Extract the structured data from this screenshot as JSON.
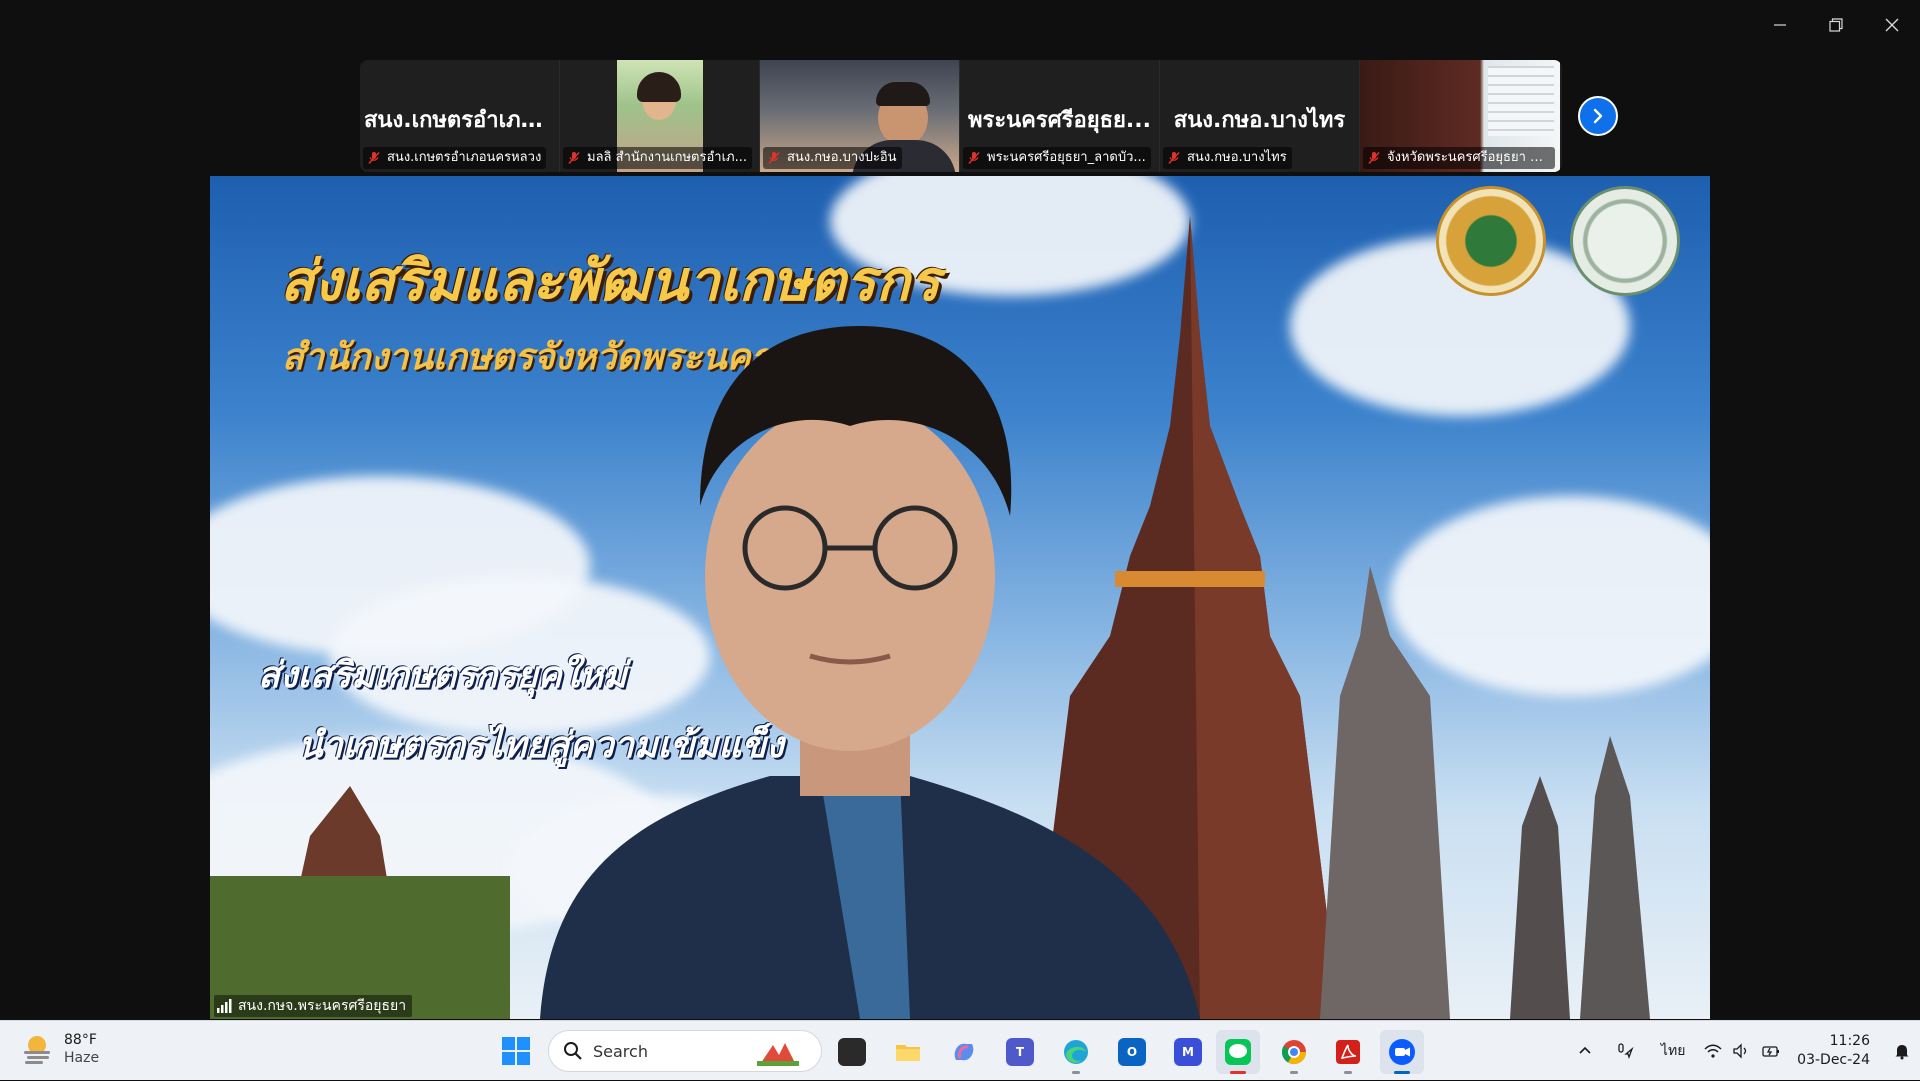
{
  "participants": [
    {
      "display_name": "สนง.เกษตรอำเภอ...",
      "caption": "สนง.เกษตรอำเภอนครหลวง",
      "video": false
    },
    {
      "display_name": "",
      "caption": "มลลิ สำนักงานเกษตรอำเภ...",
      "video": true
    },
    {
      "display_name": "",
      "caption": "สนง.กษอ.บางปะอิน",
      "video": true
    },
    {
      "display_name": "พระนครศรีอยุธย...",
      "caption": "พระนครศรีอยุธยา_ลาดบัว...",
      "video": false
    },
    {
      "display_name": "สนง.กษอ.บางไทร",
      "caption": "สนง.กษอ.บางไทร",
      "video": false
    },
    {
      "display_name": "",
      "caption": "จังหวัดพระนครศรีอยุธยา อ...",
      "video": true
    }
  ],
  "main_video": {
    "title_line1": "ส่งเสริมและพัฒนาเกษตรกร",
    "title_line2": "สำนักงานเกษตรจังหวัดพระนครศรีอ",
    "slogan_line1": "ส่งเสริมเกษตรกรยุคใหม่",
    "slogan_line2": "นำเกษตรกรไทยสู่ความเข้มแข็ง",
    "speaker_name": "สนง.กษจ.พระนครศรีอยุธยา"
  },
  "taskbar": {
    "weather": {
      "temp": "88°F",
      "condition": "Haze"
    },
    "search_placeholder": "Search",
    "apps": [
      "file-explorer",
      "copilot",
      "teams",
      "edge",
      "outlook",
      "mathtype",
      "line",
      "chrome",
      "acrobat",
      "zoom"
    ],
    "tray": {
      "language": "ไทย",
      "time": "11:26",
      "date": "03-Dec-24"
    }
  },
  "colors": {
    "zoom_blue": "#0e71eb",
    "mute_red": "#e0322c",
    "taskbar_bg": "#eef1f6"
  }
}
